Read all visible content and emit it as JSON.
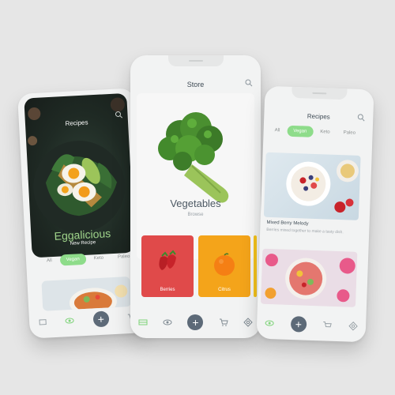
{
  "left_screen": {
    "header_title": "Recipes",
    "hero_title": "Eggalicious",
    "hero_subtitle": "New Recipe",
    "chips": [
      "All",
      "Vegan",
      "Keto",
      "Paleo"
    ],
    "active_chip": "Vegan"
  },
  "center_screen": {
    "header_title": "Store",
    "heading": "Vegetables",
    "subheading": "Browse",
    "categories": [
      {
        "label": "Berries",
        "color": "#e04a4a"
      },
      {
        "label": "Citrus",
        "color": "#f4a41a"
      }
    ]
  },
  "right_screen": {
    "header_title": "Recipes",
    "chips": [
      "All",
      "Vegan",
      "Keto",
      "Paleo"
    ],
    "active_chip": "Vegan",
    "recipe_title": "Mixed Berry Melody",
    "recipe_desc": "Berries mixed together to make a tasty dish."
  },
  "colors": {
    "accent_green": "#8edc8a",
    "fab": "#5d6a78",
    "nav_active": "#7fd37a"
  },
  "nav_icons": [
    "grid-icon",
    "eye-icon",
    "add-icon",
    "cart-icon",
    "settings-icon"
  ],
  "nav_add_symbol": "+"
}
